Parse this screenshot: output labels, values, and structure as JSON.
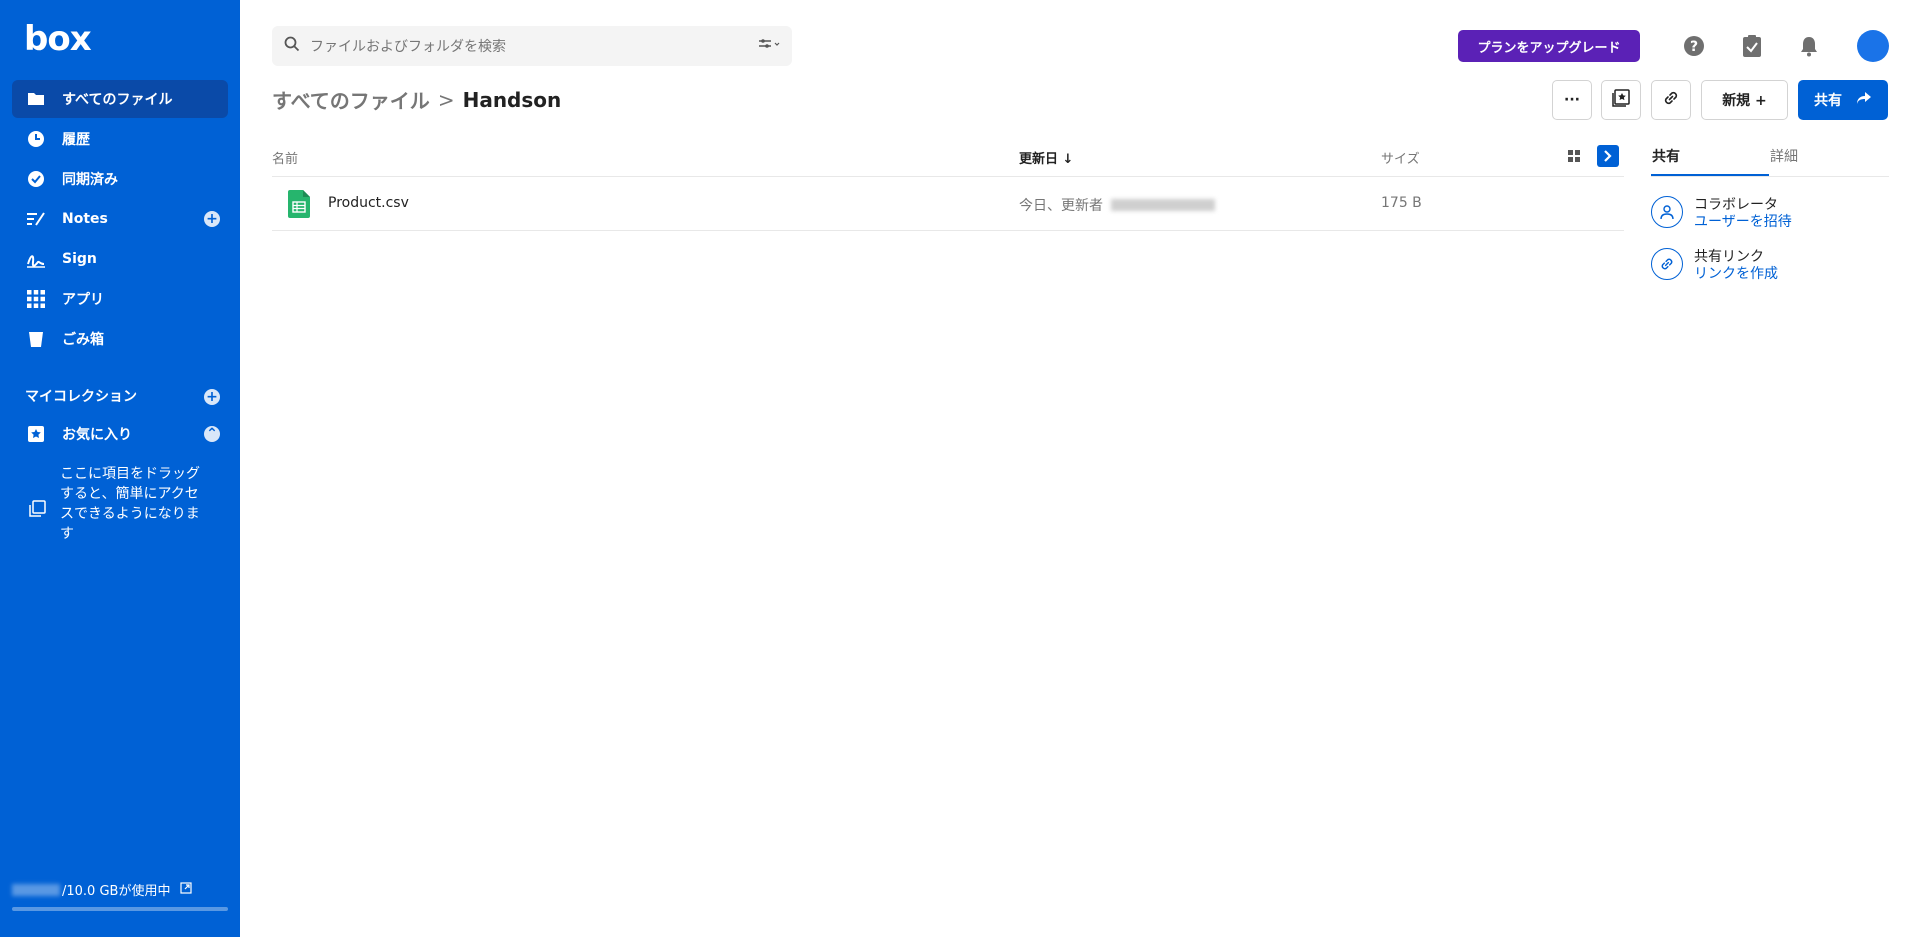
{
  "app": {
    "logo": "box"
  },
  "sidebar": {
    "items": [
      {
        "label": "すべてのファイル",
        "icon": "folder-icon"
      },
      {
        "label": "履歴",
        "icon": "clock-icon"
      },
      {
        "label": "同期済み",
        "icon": "check-circle-icon"
      },
      {
        "label": "Notes",
        "icon": "notes-icon"
      },
      {
        "label": "Sign",
        "icon": "sign-icon"
      },
      {
        "label": "アプリ",
        "icon": "apps-grid-icon"
      },
      {
        "label": "ごみ箱",
        "icon": "trash-icon"
      }
    ],
    "collections_label": "マイコレクション",
    "favorites_label": "お気に入り",
    "favorites_hint": "ここに項目をドラッグすると、簡単にアクセスできるようになります",
    "storage_label": "/10.0 GBが使用中"
  },
  "topbar": {
    "search_placeholder": "ファイルおよびフォルダを検索",
    "upgrade_label": "プランをアップグレード"
  },
  "header": {
    "breadcrumb_root": "すべてのファイル",
    "breadcrumb_sep": ">",
    "breadcrumb_current": "Handson",
    "more_label": "···",
    "new_label": "新規 +",
    "share_label": "共有"
  },
  "list": {
    "columns": {
      "name": "名前",
      "modified": "更新日 ↓",
      "size": "サイズ"
    },
    "rows": [
      {
        "name": "Product.csv",
        "modified": "今日、更新者",
        "size": "175 B"
      }
    ]
  },
  "panel": {
    "tabs": [
      "共有",
      "詳細"
    ],
    "collaborators_title": "コラボレータ",
    "collaborators_link": "ユーザーを招待",
    "shared_link_title": "共有リンク",
    "shared_link_link": "リンクを作成"
  },
  "colors": {
    "brand": "#0061d5",
    "upgrade": "#5b21b6"
  }
}
